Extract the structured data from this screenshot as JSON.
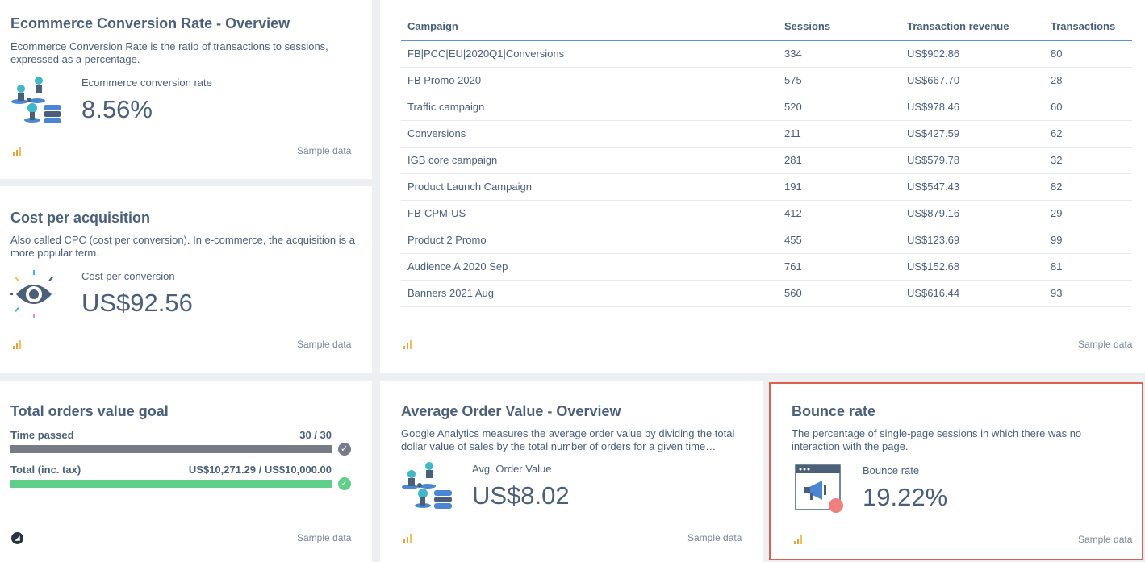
{
  "conversion_card": {
    "title": "Ecommerce Conversion Rate - Overview",
    "desc": "Ecommerce Conversion Rate is the ratio of transactions to sessions, expressed as a percentage.",
    "metric_label": "Ecommerce conversion rate",
    "metric_value": "8.56%",
    "sample": "Sample data",
    "source_icon": "google-analytics-icon",
    "illustration": "people-database-icon"
  },
  "cpa_card": {
    "title": "Cost per acquisition",
    "desc": "Also called CPC (cost per conversion). In e-commerce, the acquisition is a more popular term.",
    "metric_label": "Cost per conversion",
    "metric_value": "US$92.56",
    "sample": "Sample data",
    "source_icon": "google-analytics-icon",
    "illustration": "eye-icon"
  },
  "campaign_table": {
    "headers": [
      "Campaign",
      "Sessions",
      "Transaction revenue",
      "Transactions"
    ],
    "rows": [
      [
        "FB|PCC|EU|2020Q1|Conversions",
        "334",
        "US$902.86",
        "80"
      ],
      [
        "FB Promo 2020",
        "575",
        "US$667.70",
        "28"
      ],
      [
        "Traffic campaign",
        "520",
        "US$978.46",
        "60"
      ],
      [
        "Conversions",
        "211",
        "US$427.59",
        "62"
      ],
      [
        "IGB core campaign",
        "281",
        "US$579.78",
        "32"
      ],
      [
        "Product Launch Campaign",
        "191",
        "US$547.43",
        "82"
      ],
      [
        "FB-CPM-US",
        "412",
        "US$879.16",
        "29"
      ],
      [
        "Product 2 Promo",
        "455",
        "US$123.69",
        "99"
      ],
      [
        "Audience A 2020 Sep",
        "761",
        "US$152.68",
        "81"
      ],
      [
        "Banners 2021 Aug",
        "560",
        "US$616.44",
        "93"
      ]
    ],
    "sample": "Sample data",
    "source_icon": "google-analytics-icon"
  },
  "goal_card": {
    "title": "Total orders value goal",
    "time_label": "Time passed",
    "time_value": "30 / 30",
    "time_progress": 1.0,
    "total_label": "Total (inc. tax)",
    "total_value": "US$10,271.29 / US$10,000.00",
    "total_progress": 1.0,
    "sample": "Sample data",
    "source_icon": "bigcommerce-icon",
    "colors": {
      "time_bar": "#767b85",
      "total_bar": "#5fcf8a"
    }
  },
  "aov_card": {
    "title": "Average Order Value - Overview",
    "desc": "Google Analytics measures the average order value by dividing the total dollar value of sales by the total number of orders for a given time…",
    "metric_label": "Avg. Order Value",
    "metric_value": "US$8.02",
    "sample": "Sample data",
    "source_icon": "google-analytics-icon",
    "illustration": "people-database-icon"
  },
  "bounce_card": {
    "title": "Bounce rate",
    "desc": "The percentage of single-page sessions in which there was no interaction with the page.",
    "metric_label": "Bounce rate",
    "metric_value": "19.22%",
    "sample": "Sample data",
    "source_icon": "google-analytics-icon",
    "illustration": "browser-megaphone-icon",
    "highlight_color": "#e0604e"
  }
}
